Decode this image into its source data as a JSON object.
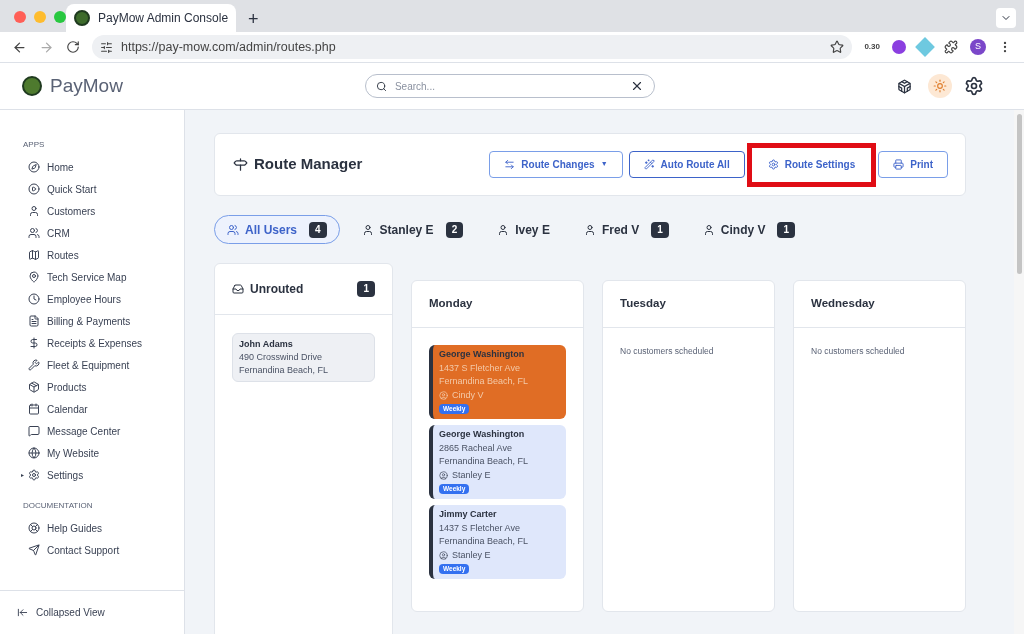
{
  "browser": {
    "tab_title": "PayMow Admin Console",
    "new_tab": "+",
    "url": "https://pay-mow.com/admin/routes.php",
    "zoom_badge": "0.30",
    "profile": "S"
  },
  "header": {
    "brand": "PayMow",
    "search": {
      "placeholder": "Search..."
    }
  },
  "sidebar": {
    "sections": [
      {
        "title": "APPS",
        "items": [
          {
            "label": "Home"
          },
          {
            "label": "Quick Start"
          },
          {
            "label": "Customers"
          },
          {
            "label": "CRM"
          },
          {
            "label": "Routes"
          },
          {
            "label": "Tech Service Map"
          },
          {
            "label": "Employee Hours"
          },
          {
            "label": "Billing & Payments"
          },
          {
            "label": "Receipts & Expenses"
          },
          {
            "label": "Fleet & Equipment"
          },
          {
            "label": "Products"
          },
          {
            "label": "Calendar"
          },
          {
            "label": "Message Center"
          },
          {
            "label": "My Website"
          },
          {
            "label": "Settings",
            "caret": "▸"
          }
        ]
      },
      {
        "title": "DOCUMENTATION",
        "items": [
          {
            "label": "Help Guides"
          },
          {
            "label": "Contact Support"
          }
        ]
      }
    ],
    "footer": "Collapsed View"
  },
  "route_manager": {
    "title": "Route Manager",
    "buttons": [
      {
        "label": "Route Changes",
        "caret": "▼",
        "highlighted": false
      },
      {
        "label": "Auto Route All",
        "highlighted": false
      },
      {
        "label": "Route Settings",
        "highlighted": true
      },
      {
        "label": "Print",
        "highlighted": false
      }
    ]
  },
  "user_tabs": [
    {
      "label": "All Users",
      "count": "4",
      "selected": true
    },
    {
      "label": "Stanley E",
      "count": "2",
      "selected": false
    },
    {
      "label": "Ivey E",
      "selected": false
    },
    {
      "label": "Fred V",
      "count": "1",
      "selected": false
    },
    {
      "label": "Cindy V",
      "count": "1",
      "selected": false
    }
  ],
  "unrouted": {
    "title": "Unrouted",
    "count": "1",
    "customers": [
      {
        "name": "John Adams",
        "address": "490 Crosswind Drive",
        "city": "Fernandina Beach, FL"
      }
    ]
  },
  "days": [
    {
      "name": "Monday",
      "stops": [
        {
          "name": "George Washington",
          "address": "1437 S Fletcher Ave",
          "city": "Fernandina Beach, FL",
          "tech": "Cindy V",
          "frequency": "Weekly",
          "color": "#e06d25"
        },
        {
          "name": "George Washington",
          "address": "2865 Racheal Ave",
          "city": "Fernandina Beach, FL",
          "tech": "Stanley E",
          "frequency": "Weekly",
          "color": "#dfe7fb"
        },
        {
          "name": "Jimmy Carter",
          "address": "1437 S Fletcher Ave",
          "city": "Fernandina Beach, FL",
          "tech": "Stanley E",
          "frequency": "Weekly",
          "color": "#dfe7fb"
        }
      ]
    },
    {
      "name": "Tuesday",
      "empty": "No customers scheduled"
    },
    {
      "name": "Wednesday",
      "empty": "No customers scheduled"
    }
  ]
}
